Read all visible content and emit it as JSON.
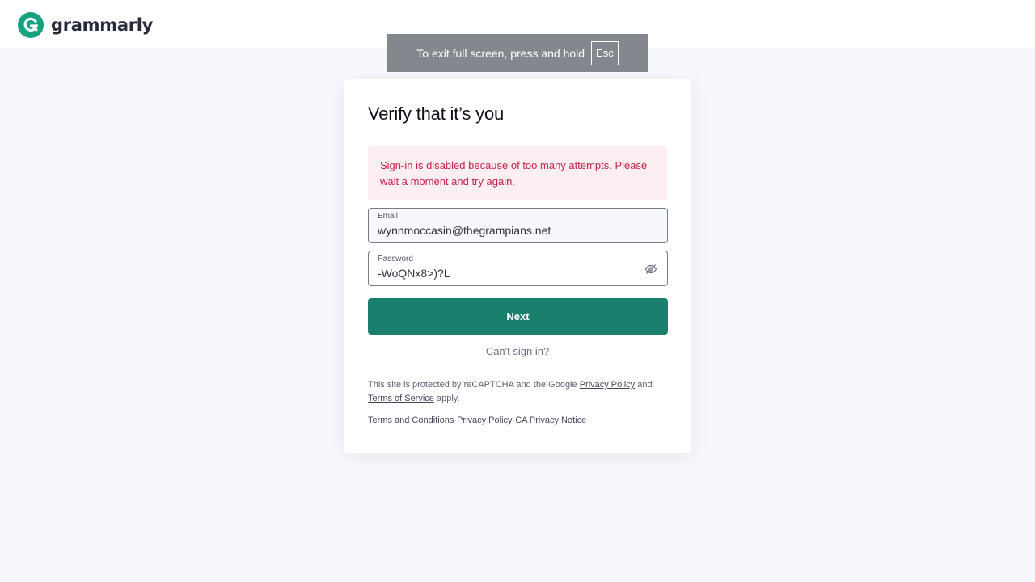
{
  "brand": {
    "name": "grammarly",
    "accent_color": "#15a37f",
    "button_color": "#1b7f6e"
  },
  "fullscreen_banner": {
    "message": "To exit full screen, press and hold",
    "key": "Esc"
  },
  "card": {
    "title": "Verify that it’s you",
    "alert": {
      "text": "Sign-in is disabled because of too many attempts. Please wait a moment and try again.",
      "color": "#c5224d"
    },
    "email": {
      "label": "Email",
      "value": "wynnmoccasin@thegrampians.net"
    },
    "password": {
      "label": "Password",
      "value": "-WoQNx8>)?L",
      "toggle_icon": "eye-off-icon"
    },
    "next_label": "Next",
    "cant_sign_in": "Can't sign in?",
    "recaptcha": {
      "prefix": "This site is protected by reCAPTCHA and the Google",
      "privacy_link": "Privacy Policy",
      "middle": "and",
      "terms_link": "Terms of Service",
      "suffix": "apply."
    },
    "footer": {
      "terms": "Terms and Conditions",
      "privacy": "Privacy Policy",
      "ca_privacy": "CA Privacy Notice",
      "separator": "·"
    }
  }
}
